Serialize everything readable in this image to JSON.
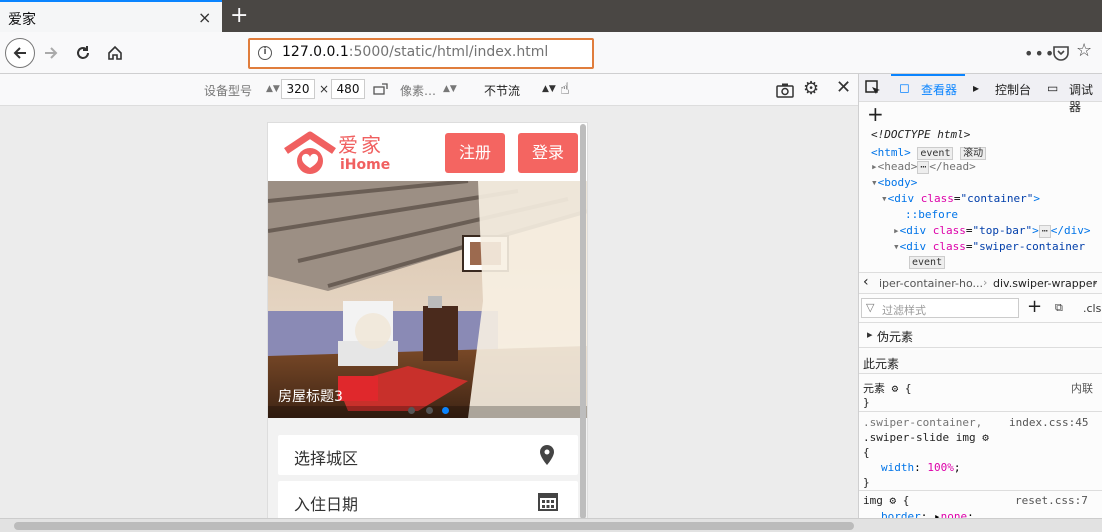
{
  "browser": {
    "tab_title": "爱家",
    "tab_close": "×",
    "new_tab": "+",
    "url_host": "127.0.0.1",
    "url_rest": ":5000/static/html/index.html",
    "more": "•••"
  },
  "rdm": {
    "device_label": "设备型号",
    "width": "320",
    "times": "×",
    "height": "480",
    "pixel_label": "像素…",
    "throttle_label": "不节流"
  },
  "page": {
    "logo_cn": "爱家",
    "logo_en": "iHome",
    "register": "注册",
    "login": "登录",
    "slide_caption": "房屋标题3",
    "field_area": "选择城区",
    "field_date": "入住日期"
  },
  "devtools": {
    "tab_inspector": "查看器",
    "tab_console": "控制台",
    "tab_debugger": "调试器",
    "add": "+",
    "doctype": "<!DOCTYPE html>",
    "html_tag": "<html>",
    "badge_event": "event",
    "badge_scroll": "滚动",
    "head_open": "<head>",
    "head_close": "</head>",
    "body_tag": "<body>",
    "div_open": "<div",
    "div_close": "</div>",
    "attr_class": "class",
    "container_class": "\"container\"",
    "before": "::before",
    "topbar_class": "\"top-bar\"",
    "swiper_class": "\"swiper-container",
    "crumb1": "iper-container-ho...",
    "crumb2": "div.swiper-wrapper",
    "filter_placeholder": "过滤样式",
    "cls": ".cls",
    "pseudo": "伪元素",
    "this_element": "此元素",
    "element_label": "元素",
    "open_brace": "{",
    "close_brace": "}",
    "inline": "内联",
    "rule1_sel1": ".swiper-container,",
    "rule1_src": "index.css:45",
    "rule1_sel2": ".swiper-slide img",
    "rule1_prop": "width",
    "rule1_val": "100%",
    "rule2_sel": "img",
    "rule2_src": "reset.css:7",
    "rule2_prop": "border",
    "rule2_val": "none"
  },
  "colors": {
    "brand": "#f46561",
    "url_highlight": "#e07d3c",
    "devtools_accent": "#0a84ff"
  }
}
